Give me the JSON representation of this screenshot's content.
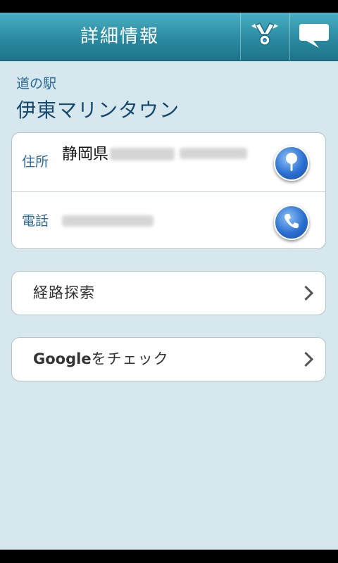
{
  "header": {
    "title": "詳細情報",
    "share_icon": "share-icon",
    "comment_icon": "comment-icon"
  },
  "place": {
    "category": "道の駅",
    "name": "伊東マリンタウン"
  },
  "info": {
    "address_label": "住所",
    "address_prefecture": "静岡県",
    "address_icon": "map-pin-icon",
    "phone_label": "電話",
    "phone_icon": "phone-icon"
  },
  "actions": {
    "route_label": "経路探索",
    "google_brand": "Google",
    "google_suffix": "をチェック"
  },
  "colors": {
    "header": "#2a8aa1",
    "background": "#d6e8ee",
    "label": "#2a6a9a",
    "name": "#16496e",
    "button": "#2b6fd0"
  }
}
